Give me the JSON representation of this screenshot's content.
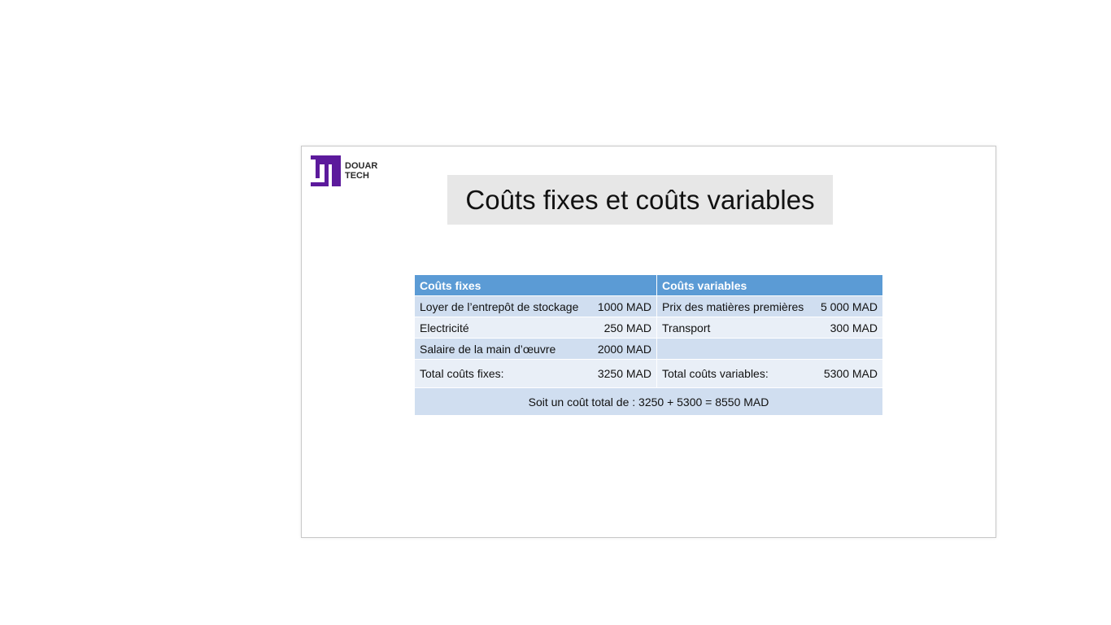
{
  "logo": {
    "line1": "DOUAR",
    "line2": "TECH",
    "color": "#5c1a9c"
  },
  "slide": {
    "title": "Coûts fixes et coûts variables"
  },
  "table": {
    "headers": {
      "fixed": "Coûts fixes",
      "variable": "Coûts variables"
    },
    "rows": [
      {
        "fixed_label": "Loyer de l’entrepôt de stockage",
        "fixed_value": "1000 MAD",
        "variable_label": "Prix des matières premières",
        "variable_value": "5 000 MAD"
      },
      {
        "fixed_label": "Electricité",
        "fixed_value": "250 MAD",
        "variable_label": "Transport",
        "variable_value": "300 MAD"
      },
      {
        "fixed_label": "Salaire de la main d’œuvre",
        "fixed_value": "2000 MAD",
        "variable_label": "",
        "variable_value": ""
      }
    ],
    "totals": {
      "fixed_label": "Total coûts fixes:",
      "fixed_value": "3250 MAD",
      "variable_label": "Total coûts variables:",
      "variable_value": "5300 MAD"
    },
    "summary": "Soit un coût total de :  3250 + 5300 =  8550 MAD"
  },
  "colors": {
    "header_bg": "#5b9bd5",
    "row_dark": "#d0def0",
    "row_light": "#e9eff7",
    "title_bg": "#e7e7e7"
  }
}
